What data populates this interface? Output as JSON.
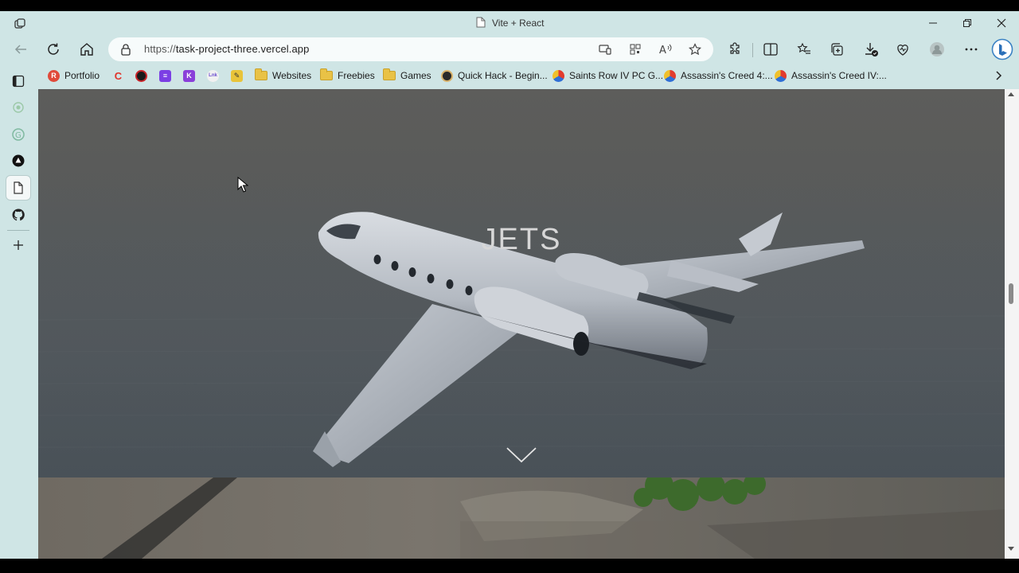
{
  "window": {
    "tab_title": "Vite + React",
    "minimize_icon": "minimize-icon",
    "restore_icon": "restore-icon",
    "close_icon": "close-icon"
  },
  "navbar": {
    "url": "https://task-project-three.vercel.app",
    "url_prefix": "https://",
    "url_host": "task-project-three.vercel.app"
  },
  "bookmarks": [
    {
      "label": "Portfolio",
      "icon": "portfolio-icon"
    },
    {
      "label": "",
      "icon": "c-icon"
    },
    {
      "label": "",
      "icon": "red-circle-icon"
    },
    {
      "label": "",
      "icon": "purple-icon"
    },
    {
      "label": "",
      "icon": "k-icon"
    },
    {
      "label": "",
      "icon": "lnk-icon"
    },
    {
      "label": "",
      "icon": "pen-icon"
    },
    {
      "label": "Websites",
      "icon": "folder-icon"
    },
    {
      "label": "Freebies",
      "icon": "folder-icon"
    },
    {
      "label": "Games",
      "icon": "folder-icon"
    },
    {
      "label": "Quick Hack - Begin...",
      "icon": "hack-icon"
    },
    {
      "label": "Saints Row IV PC G...",
      "icon": "game-icon"
    },
    {
      "label": "Assassin's Creed 4:...",
      "icon": "game-icon"
    },
    {
      "label": "Assassin's Creed IV:...",
      "icon": "game-icon"
    }
  ],
  "hero": {
    "title": "JETS"
  },
  "colors": {
    "chrome_bg": "#cfe5e5",
    "address_bg": "#f7fbfb",
    "hero_title": "#d7d7d7"
  }
}
